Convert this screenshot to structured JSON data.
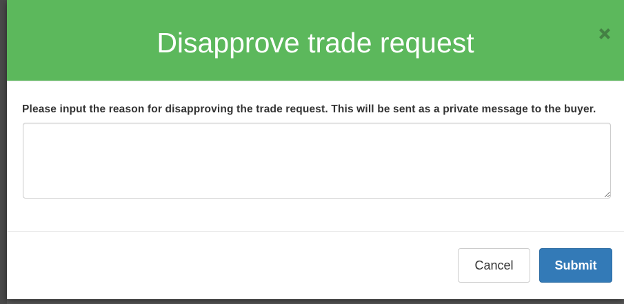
{
  "modal": {
    "title": "Disapprove trade request",
    "close_icon": "close-icon",
    "header_color": "#5cb85c"
  },
  "form": {
    "label": "Please input the reason for disapproving the trade request. This will be sent as a private message to the buyer.",
    "reason_value": "",
    "reason_placeholder": ""
  },
  "footer": {
    "cancel_label": "Cancel",
    "submit_label": "Submit",
    "submit_color": "#337ab7"
  }
}
